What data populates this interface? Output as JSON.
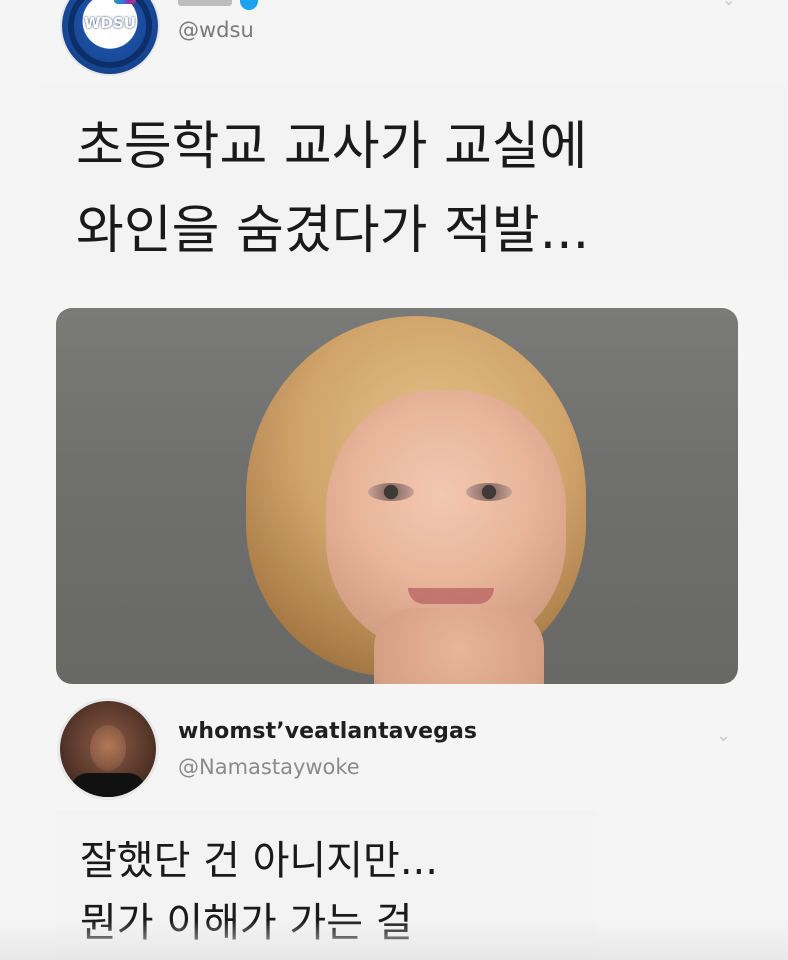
{
  "tweet1": {
    "avatar_logo_text": "WDSU",
    "handle": "@wdsu",
    "caption": {
      "line1": "초등학교 교사가 교실에",
      "line2": "와인을 숨겼다가 적발..."
    }
  },
  "photo": {
    "icon": "photo"
  },
  "tweet2": {
    "name": "whomst’veatlantavegas",
    "handle": "@Namastaywoke",
    "caption": {
      "line1": "잘했단 건 아니지만...",
      "line2": "뭔가 이해가 가는 걸"
    }
  },
  "icons": {
    "verified": "verified-badge-icon",
    "menu": "chevron-down-icon"
  },
  "colors": {
    "background": "#f5f5f5",
    "caption_bg": "#f3f3f3",
    "handle_gray": "#7a7a7a",
    "name_black": "#1f1f1f",
    "verified_blue": "#1da1f2"
  }
}
